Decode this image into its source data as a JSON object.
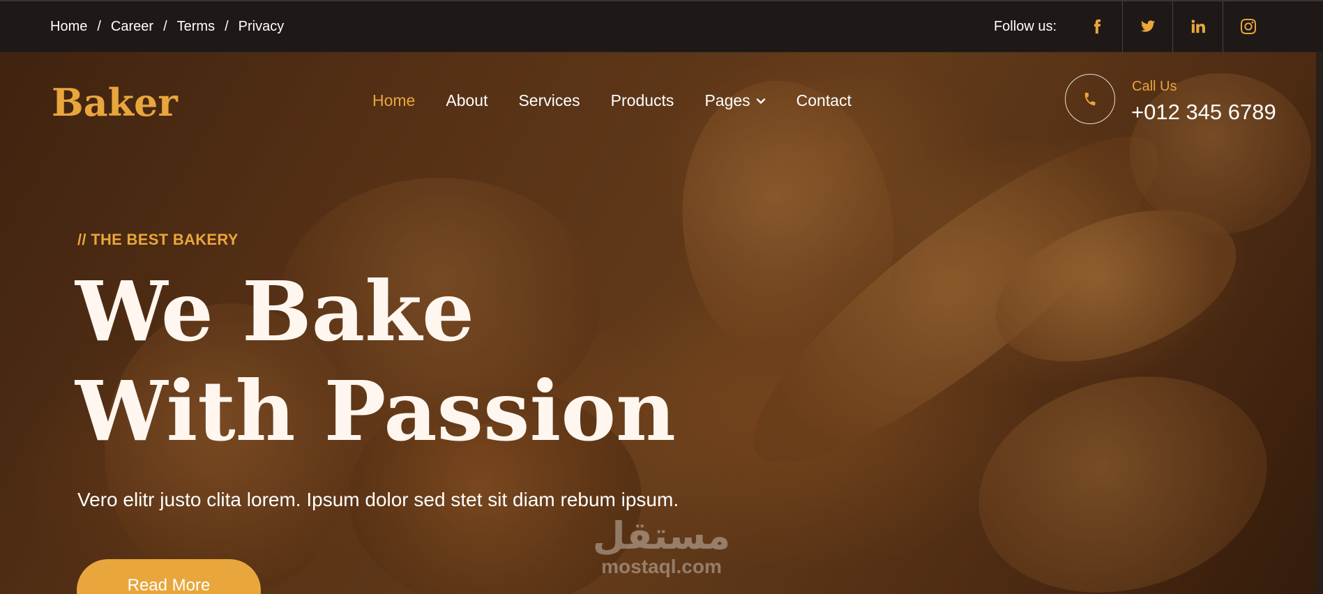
{
  "topbar": {
    "breadcrumbs": [
      "Home",
      "Career",
      "Terms",
      "Privacy"
    ],
    "separator": "/",
    "follow_label": "Follow us:",
    "social_icons": [
      "facebook-icon",
      "twitter-icon",
      "linkedin-icon",
      "instagram-icon"
    ]
  },
  "brand": {
    "name": "Baker"
  },
  "nav": {
    "items": [
      "Home",
      "About",
      "Services",
      "Products",
      "Pages",
      "Contact"
    ],
    "active": "Home"
  },
  "contact": {
    "label": "Call Us",
    "phone": "+012 345 6789"
  },
  "hero": {
    "eyebrow": "// THE BEST BAKERY",
    "headline": "We Bake With Passion",
    "lead": "Vero elitr justo clita lorem. Ipsum dolor sed stet sit diam rebum ipsum.",
    "button": "Read More"
  },
  "watermark": {
    "arabic": "مستقل",
    "latin": "mostaql.com"
  },
  "colors": {
    "accent": "#e9a63c",
    "topbar_bg": "#1e1816",
    "text_light": "#ffffff"
  }
}
